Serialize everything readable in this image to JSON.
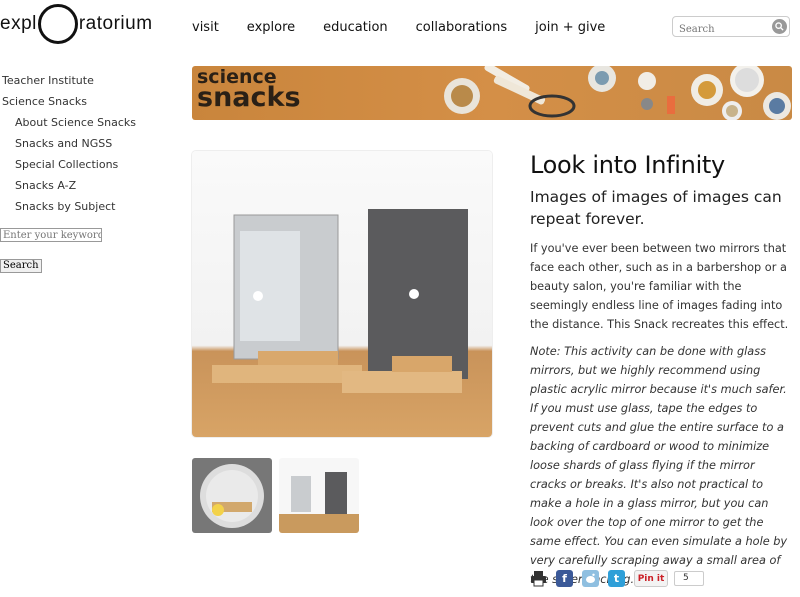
{
  "header": {
    "logo_left": "expl",
    "logo_right": "ratorium",
    "nav": [
      "visit",
      "explore",
      "education",
      "collaborations",
      "join + give"
    ],
    "search_placeholder": "Search"
  },
  "sidebar": {
    "items": [
      {
        "label": "Teacher Institute",
        "level": 0
      },
      {
        "label": "Science Snacks",
        "level": 0
      },
      {
        "label": "About Science Snacks",
        "level": 1
      },
      {
        "label": "Snacks and NGSS",
        "level": 1
      },
      {
        "label": "Special Collections",
        "level": 1
      },
      {
        "label": "Snacks A-Z",
        "level": 1
      },
      {
        "label": "Snacks by Subject",
        "level": 1
      }
    ],
    "keyword_placeholder": "Enter your keywords",
    "search_button": "Search"
  },
  "banner": {
    "word1": "science",
    "word2": "snacks"
  },
  "article": {
    "title": "Look into Infinity",
    "subtitle": "Images of images of images can repeat forever.",
    "paragraph": "If you've ever been between two mirrors that face each other, such as in a barbershop or a beauty salon, you're familiar with the seemingly endless line of images fading into the distance. This Snack recreates this effect.",
    "note": "Note: This activity can be done with glass mirrors, but we highly recommend using plastic acrylic mirror because it's much safer. If you must use glass, tape the edges to prevent cuts and glue the entire surface to a backing of cardboard or wood to minimize loose shards of glass flying if the mirror cracks or breaks. It's also not practical to make a hole in a glass mirror, but you can look over the top of one mirror to get the same effect. You can even simulate a hole by very carefully scraping away a small area of the silver backing."
  },
  "social": {
    "pin_label": "Pin it",
    "pin_count": "5",
    "icons": [
      "print-icon",
      "facebook-icon",
      "reddit-icon",
      "twitter-icon"
    ],
    "colors": {
      "facebook": "#3b5998",
      "reddit": "#8fbfe0",
      "twitter": "#2f9fd8"
    }
  }
}
